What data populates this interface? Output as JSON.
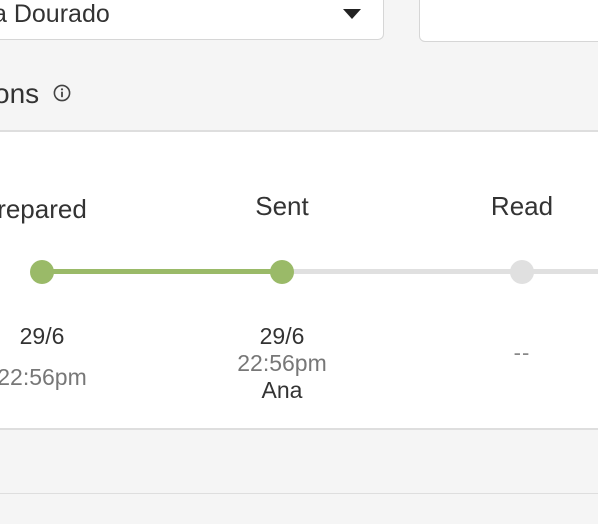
{
  "filter": {
    "selected_value": "a Dourado"
  },
  "section": {
    "title": "ons"
  },
  "colors": {
    "complete": "#9aba68",
    "pending": "#e0e0e0"
  },
  "timeline": {
    "steps": [
      {
        "label": "repared",
        "date": "29/6",
        "time": "22:56pm",
        "user": "",
        "empty": ""
      },
      {
        "label": "Sent",
        "date": "29/6",
        "time": "22:56pm",
        "user": "Ana",
        "empty": ""
      },
      {
        "label": "Read",
        "date": "",
        "time": "",
        "user": "",
        "empty": "--"
      }
    ]
  }
}
